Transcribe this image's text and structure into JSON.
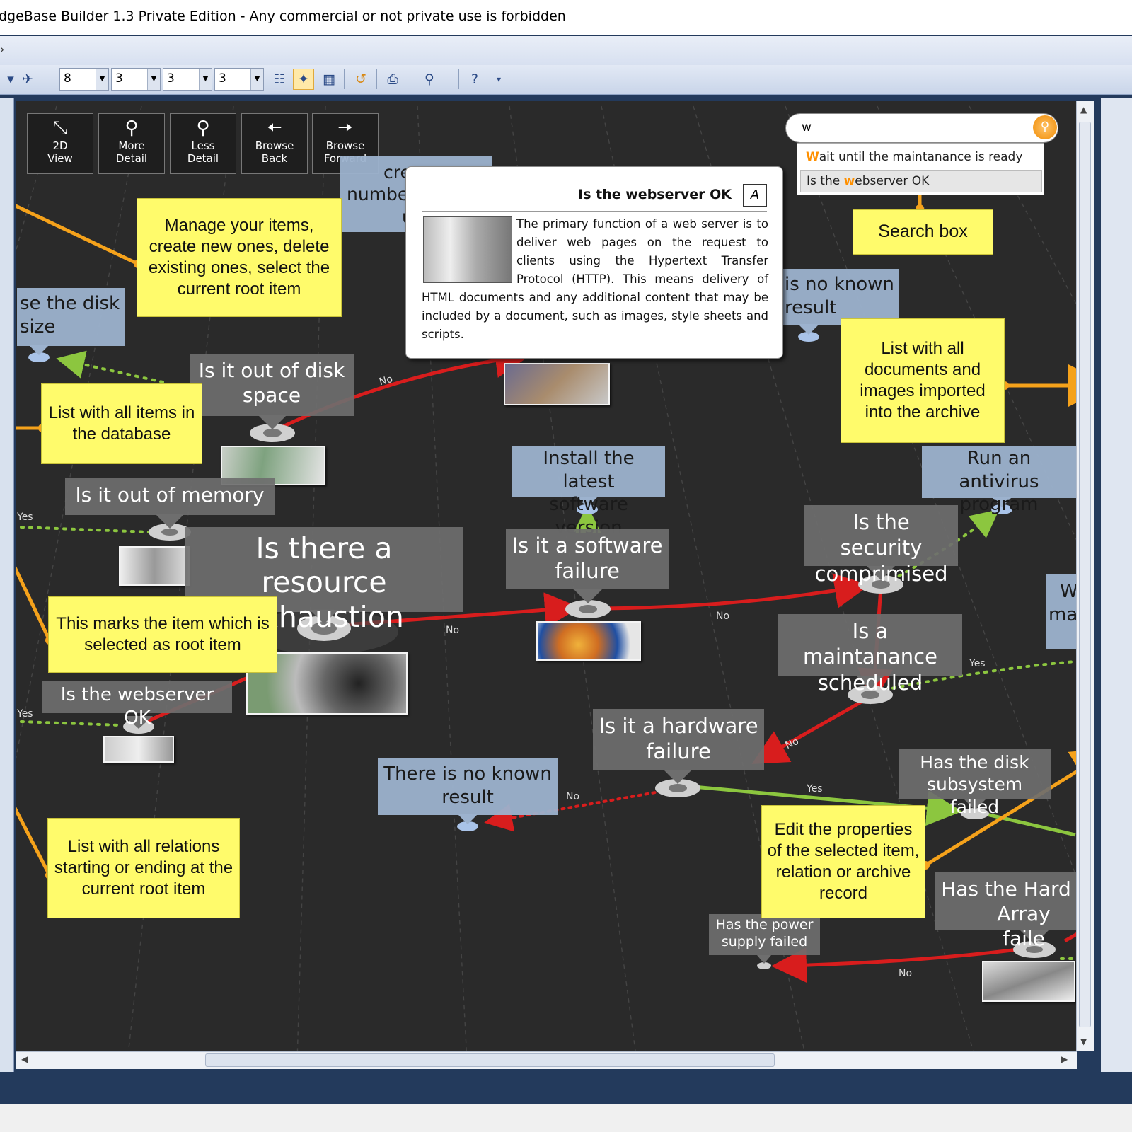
{
  "window": {
    "title": "dgeBase Builder 1.3 Private Edition - Any commercial or not private use is forbidden"
  },
  "toolbar": {
    "combos": [
      "8",
      "3",
      "3",
      "3"
    ]
  },
  "nav_buttons": [
    {
      "line1": "2D",
      "line2": "View",
      "icon": "2d-view-icon"
    },
    {
      "line1": "More",
      "line2": "Detail",
      "icon": "zoom-in-icon"
    },
    {
      "line1": "Less",
      "line2": "Detail",
      "icon": "zoom-out-icon"
    },
    {
      "line1": "Browse",
      "line2": "Back",
      "icon": "arrow-left-icon"
    },
    {
      "line1": "Browse",
      "line2": "Forward",
      "icon": "arrow-right-icon"
    }
  ],
  "search": {
    "value": "w",
    "suggestions": [
      {
        "hl": "W",
        "rest_a": "ait until the m",
        "rest_b": "aintanance is ready"
      },
      {
        "pre": "Is the ",
        "hl": "w",
        "rest_a": "ebserver ",
        "rest_b": "OK"
      }
    ]
  },
  "popup": {
    "title": "Is the webserver OK",
    "body": "The primary function of a web server is to deliver web pages on the request to clients using the Hypertext Transfer Protocol (HTTP). This means delivery of HTML documents and any additional content that may be included by a document, such as images, style sheets and scripts."
  },
  "nodes": {
    "increase_partial": "cre",
    "increase_partial2": "numbe",
    "increase_partial3": "u",
    "disk_size_1": "se the disk",
    "disk_size_2": "size",
    "out_of_disk_1": "Is it out of disk",
    "out_of_disk_2": "space",
    "out_of_memory": "Is it out of memory",
    "resource_1": "Is there a resource",
    "resource_2": "exhaustion",
    "webserver_ok": "Is the webserver OK",
    "install_1": "Install the latest",
    "install_2": "software version",
    "software_1": "Is it a software",
    "software_2": "failure",
    "no_known_top_1": "is no known",
    "no_known_top_2": "result",
    "antivirus_1": "Run an antivirus",
    "antivirus_2": "program",
    "security_1": "Is the security",
    "security_2": "comprimised",
    "maintanance_1": "Is a maintanance",
    "maintanance_2": "scheduled",
    "hardware_1": "Is it a hardware",
    "hardware_2": "failure",
    "no_known_1": "There is no known",
    "no_known_2": "result",
    "disk_subsystem_1": "Has the disk",
    "disk_subsystem_2": "subsystem failed",
    "hard_array_1": "Has the Hard",
    "hard_array_2": "Array faile",
    "power_1": "Has the power",
    "power_2": "supply failed",
    "wait_partial_1": "W",
    "wait_partial_2": "ma"
  },
  "relation_labels": {
    "no": "No",
    "yes": "Yes"
  },
  "callouts": {
    "manage": "Manage your items, create new ones, delete existing ones, select the current root item",
    "items_list": "List with all items in the database",
    "root_marker": "This marks the item which is selected as root item",
    "relations_list": "List with all relations starting or ending at the current root item",
    "search_box": "Search box",
    "documents": "List with all documents and images imported into the archive",
    "properties": "Edit the properties of the selected item, relation or archive record"
  },
  "colors": {
    "graph_bg": "#2a2a2a",
    "sticky": "#fffb6b",
    "accent_orange": "#f5a21b",
    "relation_no": "#d81d1d",
    "relation_yes": "#8cc63f",
    "window_frame": "#233a5c"
  }
}
